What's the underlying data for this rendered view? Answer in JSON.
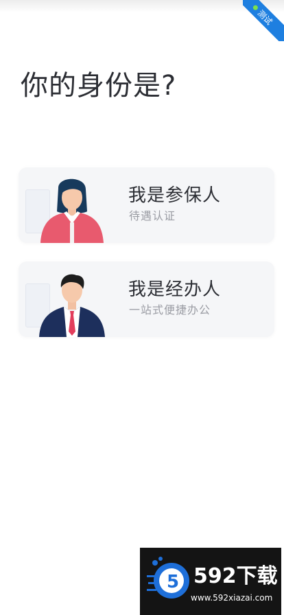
{
  "corner_ribbon": {
    "label": "测试",
    "bg_color": "#1e7fe0"
  },
  "page": {
    "title": "你的身份是?"
  },
  "roles": [
    {
      "title": "我是参保人",
      "subtitle": "待遇认证",
      "avatar": "female-person-avatar"
    },
    {
      "title": "我是经办人",
      "subtitle": "一站式便捷办公",
      "avatar": "male-person-avatar"
    }
  ],
  "watermark": {
    "brand": "592下载",
    "url": "www.592xiazai.com"
  }
}
